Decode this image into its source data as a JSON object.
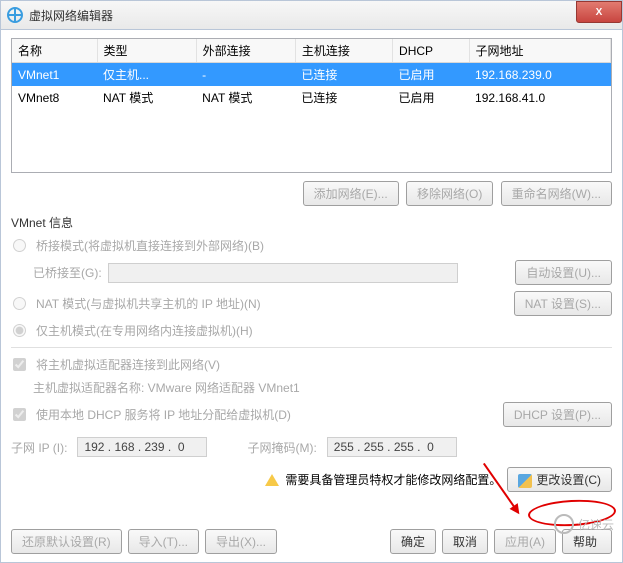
{
  "titlebar": {
    "title": "虚拟网络编辑器",
    "close": "X"
  },
  "table": {
    "headers": [
      "名称",
      "类型",
      "外部连接",
      "主机连接",
      "DHCP",
      "子网地址"
    ],
    "rows": [
      {
        "name": "VMnet1",
        "type": "仅主机...",
        "ext": "-",
        "host": "已连接",
        "dhcp": "已启用",
        "subnet": "192.168.239.0",
        "selected": true
      },
      {
        "name": "VMnet8",
        "type": "NAT 模式",
        "ext": "NAT 模式",
        "host": "已连接",
        "dhcp": "已启用",
        "subnet": "192.168.41.0",
        "selected": false
      }
    ]
  },
  "net_buttons": {
    "add": "添加网络(E)...",
    "remove": "移除网络(O)",
    "rename": "重命名网络(W)..."
  },
  "info": {
    "title": "VMnet 信息",
    "bridged": "桥接模式(将虚拟机直接连接到外部网络)(B)",
    "bridged_to_label": "已桥接至(G):",
    "auto_settings": "自动设置(U)...",
    "nat": "NAT 模式(与虚拟机共享主机的 IP 地址)(N)",
    "nat_settings": "NAT 设置(S)...",
    "hostonly": "仅主机模式(在专用网络内连接虚拟机)(H)",
    "host_adapter_connect": "将主机虚拟适配器连接到此网络(V)",
    "host_adapter_name": "主机虚拟适配器名称: VMware 网络适配器 VMnet1",
    "use_dhcp": "使用本地 DHCP 服务将 IP 地址分配给虚拟机(D)",
    "dhcp_settings": "DHCP 设置(P)...",
    "subnet_ip_label": "子网 IP (I):",
    "subnet_ip": "192 . 168 . 239 .  0",
    "subnet_mask_label": "子网掩码(M):",
    "subnet_mask": "255 . 255 . 255 .  0"
  },
  "admin": {
    "msg": "需要具备管理员特权才能修改网络配置。",
    "change": "更改设置(C)"
  },
  "footer": {
    "restore": "还原默认设置(R)",
    "import": "导入(T)...",
    "export": "导出(X)...",
    "ok": "确定",
    "cancel": "取消",
    "apply": "应用(A)",
    "help": "帮助"
  },
  "watermark": "亿速云"
}
